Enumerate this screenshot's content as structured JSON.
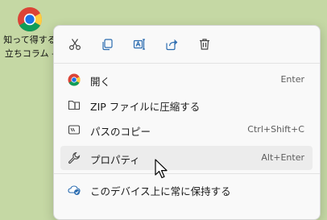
{
  "desktop": {
    "shortcut_label_line1": "知って得する",
    "shortcut_label_line2": "立ちコラム -"
  },
  "toolbar": {
    "buttons": [
      {
        "icon": "cut-icon"
      },
      {
        "icon": "copy-icon"
      },
      {
        "icon": "rename-icon"
      },
      {
        "icon": "share-icon"
      },
      {
        "icon": "delete-icon"
      }
    ]
  },
  "menu": {
    "items": [
      {
        "label": "開く",
        "shortcut": "Enter",
        "icon": "chrome-icon"
      },
      {
        "label": "ZIP ファイルに圧縮する",
        "shortcut": "",
        "icon": "zip-folder-icon"
      },
      {
        "label": "パスのコピー",
        "shortcut": "Ctrl+Shift+C",
        "icon": "copy-path-icon"
      },
      {
        "label": "プロパティ",
        "shortcut": "Alt+Enter",
        "icon": "wrench-icon"
      },
      {
        "label": "このデバイス上に常に保持する",
        "shortcut": "",
        "icon": "onedrive-icon"
      }
    ]
  },
  "colors": {
    "desktop_bg": "#c5d8a4",
    "menu_bg": "#f9f9f9",
    "highlight_bg": "#ececec",
    "accent_blue": "#2b6cb0"
  }
}
